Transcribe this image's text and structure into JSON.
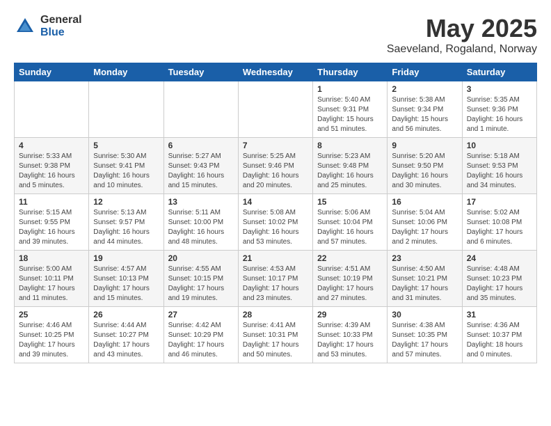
{
  "logo": {
    "general": "General",
    "blue": "Blue"
  },
  "title": "May 2025",
  "location": "Saeveland, Rogaland, Norway",
  "weekdays": [
    "Sunday",
    "Monday",
    "Tuesday",
    "Wednesday",
    "Thursday",
    "Friday",
    "Saturday"
  ],
  "weeks": [
    [
      {
        "day": "",
        "info": ""
      },
      {
        "day": "",
        "info": ""
      },
      {
        "day": "",
        "info": ""
      },
      {
        "day": "",
        "info": ""
      },
      {
        "day": "1",
        "info": "Sunrise: 5:40 AM\nSunset: 9:31 PM\nDaylight: 15 hours\nand 51 minutes."
      },
      {
        "day": "2",
        "info": "Sunrise: 5:38 AM\nSunset: 9:34 PM\nDaylight: 15 hours\nand 56 minutes."
      },
      {
        "day": "3",
        "info": "Sunrise: 5:35 AM\nSunset: 9:36 PM\nDaylight: 16 hours\nand 1 minute."
      }
    ],
    [
      {
        "day": "4",
        "info": "Sunrise: 5:33 AM\nSunset: 9:38 PM\nDaylight: 16 hours\nand 5 minutes."
      },
      {
        "day": "5",
        "info": "Sunrise: 5:30 AM\nSunset: 9:41 PM\nDaylight: 16 hours\nand 10 minutes."
      },
      {
        "day": "6",
        "info": "Sunrise: 5:27 AM\nSunset: 9:43 PM\nDaylight: 16 hours\nand 15 minutes."
      },
      {
        "day": "7",
        "info": "Sunrise: 5:25 AM\nSunset: 9:46 PM\nDaylight: 16 hours\nand 20 minutes."
      },
      {
        "day": "8",
        "info": "Sunrise: 5:23 AM\nSunset: 9:48 PM\nDaylight: 16 hours\nand 25 minutes."
      },
      {
        "day": "9",
        "info": "Sunrise: 5:20 AM\nSunset: 9:50 PM\nDaylight: 16 hours\nand 30 minutes."
      },
      {
        "day": "10",
        "info": "Sunrise: 5:18 AM\nSunset: 9:53 PM\nDaylight: 16 hours\nand 34 minutes."
      }
    ],
    [
      {
        "day": "11",
        "info": "Sunrise: 5:15 AM\nSunset: 9:55 PM\nDaylight: 16 hours\nand 39 minutes."
      },
      {
        "day": "12",
        "info": "Sunrise: 5:13 AM\nSunset: 9:57 PM\nDaylight: 16 hours\nand 44 minutes."
      },
      {
        "day": "13",
        "info": "Sunrise: 5:11 AM\nSunset: 10:00 PM\nDaylight: 16 hours\nand 48 minutes."
      },
      {
        "day": "14",
        "info": "Sunrise: 5:08 AM\nSunset: 10:02 PM\nDaylight: 16 hours\nand 53 minutes."
      },
      {
        "day": "15",
        "info": "Sunrise: 5:06 AM\nSunset: 10:04 PM\nDaylight: 16 hours\nand 57 minutes."
      },
      {
        "day": "16",
        "info": "Sunrise: 5:04 AM\nSunset: 10:06 PM\nDaylight: 17 hours\nand 2 minutes."
      },
      {
        "day": "17",
        "info": "Sunrise: 5:02 AM\nSunset: 10:08 PM\nDaylight: 17 hours\nand 6 minutes."
      }
    ],
    [
      {
        "day": "18",
        "info": "Sunrise: 5:00 AM\nSunset: 10:11 PM\nDaylight: 17 hours\nand 11 minutes."
      },
      {
        "day": "19",
        "info": "Sunrise: 4:57 AM\nSunset: 10:13 PM\nDaylight: 17 hours\nand 15 minutes."
      },
      {
        "day": "20",
        "info": "Sunrise: 4:55 AM\nSunset: 10:15 PM\nDaylight: 17 hours\nand 19 minutes."
      },
      {
        "day": "21",
        "info": "Sunrise: 4:53 AM\nSunset: 10:17 PM\nDaylight: 17 hours\nand 23 minutes."
      },
      {
        "day": "22",
        "info": "Sunrise: 4:51 AM\nSunset: 10:19 PM\nDaylight: 17 hours\nand 27 minutes."
      },
      {
        "day": "23",
        "info": "Sunrise: 4:50 AM\nSunset: 10:21 PM\nDaylight: 17 hours\nand 31 minutes."
      },
      {
        "day": "24",
        "info": "Sunrise: 4:48 AM\nSunset: 10:23 PM\nDaylight: 17 hours\nand 35 minutes."
      }
    ],
    [
      {
        "day": "25",
        "info": "Sunrise: 4:46 AM\nSunset: 10:25 PM\nDaylight: 17 hours\nand 39 minutes."
      },
      {
        "day": "26",
        "info": "Sunrise: 4:44 AM\nSunset: 10:27 PM\nDaylight: 17 hours\nand 43 minutes."
      },
      {
        "day": "27",
        "info": "Sunrise: 4:42 AM\nSunset: 10:29 PM\nDaylight: 17 hours\nand 46 minutes."
      },
      {
        "day": "28",
        "info": "Sunrise: 4:41 AM\nSunset: 10:31 PM\nDaylight: 17 hours\nand 50 minutes."
      },
      {
        "day": "29",
        "info": "Sunrise: 4:39 AM\nSunset: 10:33 PM\nDaylight: 17 hours\nand 53 minutes."
      },
      {
        "day": "30",
        "info": "Sunrise: 4:38 AM\nSunset: 10:35 PM\nDaylight: 17 hours\nand 57 minutes."
      },
      {
        "day": "31",
        "info": "Sunrise: 4:36 AM\nSunset: 10:37 PM\nDaylight: 18 hours\nand 0 minutes."
      }
    ]
  ]
}
